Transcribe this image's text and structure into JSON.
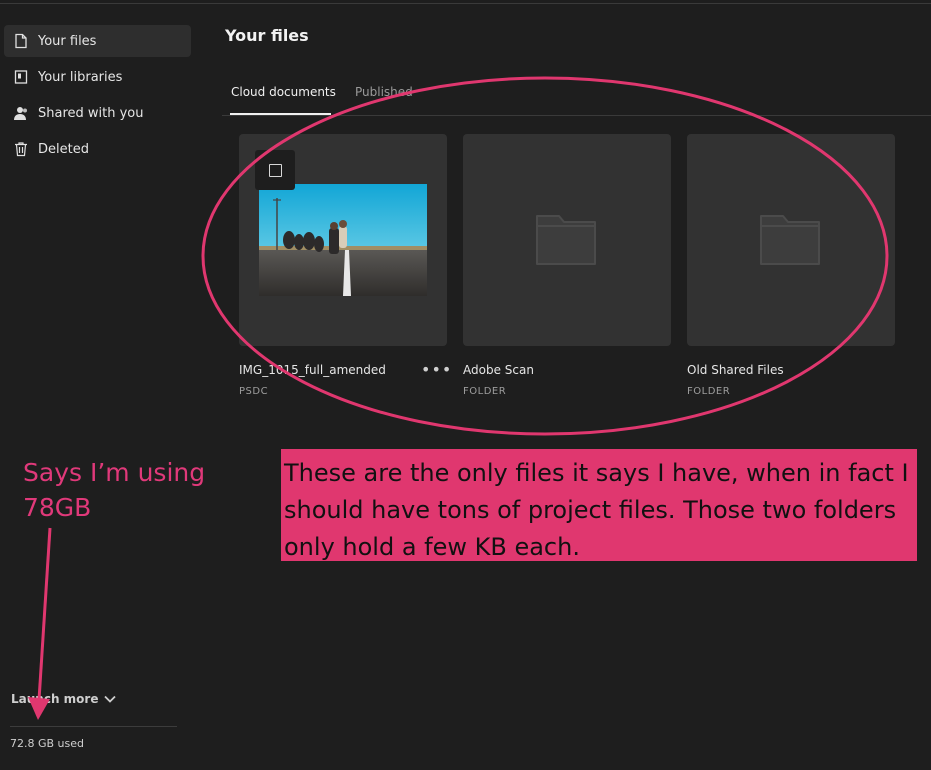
{
  "sidebar": {
    "items": [
      {
        "label": "Your files",
        "icon": "document-icon",
        "active": true
      },
      {
        "label": "Your libraries",
        "icon": "library-icon",
        "active": false
      },
      {
        "label": "Shared with you",
        "icon": "people-icon",
        "active": false
      },
      {
        "label": "Deleted",
        "icon": "trash-icon",
        "active": false
      }
    ],
    "launch_more": "Launch more",
    "storage_used": "72.8 GB used"
  },
  "main": {
    "title": "Your files",
    "tabs": [
      {
        "label": "Cloud documents",
        "active": true
      },
      {
        "label": "Published",
        "active": false
      }
    ],
    "files": [
      {
        "name": "IMG_1015_full_amended",
        "type": "PSDC",
        "kind": "image"
      },
      {
        "name": "Adobe Scan",
        "type": "FOLDER",
        "kind": "folder"
      },
      {
        "name": "Old Shared Files",
        "type": "FOLDER",
        "kind": "folder"
      }
    ],
    "more_label": "•••"
  },
  "annotations": {
    "left_note": "Says I’m using 78GB",
    "main_note": "These are the only files it says I have, when in fact I should have tons of project files. Those two folders only hold a few KB each.",
    "color": "#e0376f"
  },
  "colors": {
    "background": "#1e1e1e",
    "sidebar_active": "#2e2e2e",
    "card": "#323232",
    "folder": "#3c3c3c"
  }
}
